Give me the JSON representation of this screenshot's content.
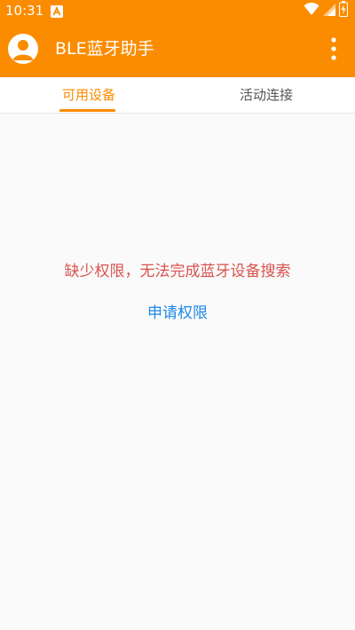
{
  "status_bar": {
    "time": "10:31",
    "icons": [
      "notification-a-icon",
      "wifi-icon",
      "signal-icon",
      "battery-charging-icon"
    ]
  },
  "app_bar": {
    "title": "BLE蓝牙助手",
    "avatar_icon": "person-avatar-icon",
    "menu_icon": "more-vert-icon"
  },
  "tabs": [
    {
      "label": "可用设备",
      "selected": true
    },
    {
      "label": "活动连接",
      "selected": false
    }
  ],
  "content": {
    "message": "缺少权限，无法完成蓝牙设备搜索",
    "action_label": "申请权限"
  },
  "colors": {
    "primary": "#fb8c00",
    "background": "#fafafa",
    "error_text": "#d9534f",
    "link": "#1e88e5"
  }
}
